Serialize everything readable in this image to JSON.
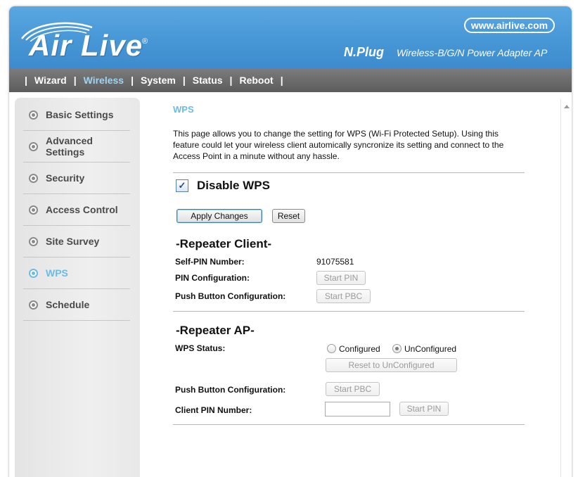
{
  "header": {
    "logo_text": "Air Live",
    "logo_reg": "®",
    "site_url": "www.airlive.com",
    "product_name": "N.Plug",
    "product_desc": "Wireless-B/G/N Power Adapter AP"
  },
  "nav": {
    "sep": "|",
    "items": [
      "Wizard",
      "Wireless",
      "System",
      "Status",
      "Reboot"
    ],
    "active": "Wireless"
  },
  "sidebar": {
    "items": [
      "Basic Settings",
      "Advanced Settings",
      "Security",
      "Access Control",
      "Site Survey",
      "WPS",
      "Schedule"
    ],
    "active": "WPS"
  },
  "content": {
    "title": "WPS",
    "intro": "This page allows you to change the setting for WPS (Wi-Fi Protected Setup). Using this feature could let your wireless client automically syncronize its setting and connect to the Access Point in a minute without any hassle.",
    "disable_wps": {
      "label": "Disable WPS",
      "checked": true,
      "check_glyph": "✓"
    },
    "apply_button": "Apply Changes",
    "reset_button": "Reset",
    "repeater_client": {
      "heading": "-Repeater Client-",
      "self_pin_label": "Self-PIN Number:",
      "self_pin_value": "91075581",
      "pin_config_label": "PIN Configuration:",
      "start_pin_button": "Start PIN",
      "push_button_label": "Push Button Configuration:",
      "start_pbc_button": "Start PBC"
    },
    "repeater_ap": {
      "heading": "-Repeater AP-",
      "wps_status_label": "WPS Status:",
      "status_options": [
        "Configured",
        "UnConfigured"
      ],
      "status_selected": "UnConfigured",
      "reset_unconfigured_button": "Reset to UnConfigured",
      "push_button_label": "Push Button Configuration:",
      "start_pbc_button": "Start PBC",
      "client_pin_label": "Client PIN Number:",
      "client_pin_value": "",
      "start_pin_button": "Start PIN"
    }
  },
  "colors": {
    "header_blue": "#4797d6",
    "nav_gray": "#6a6a6a",
    "accent_light_blue": "#6bbbe8"
  }
}
